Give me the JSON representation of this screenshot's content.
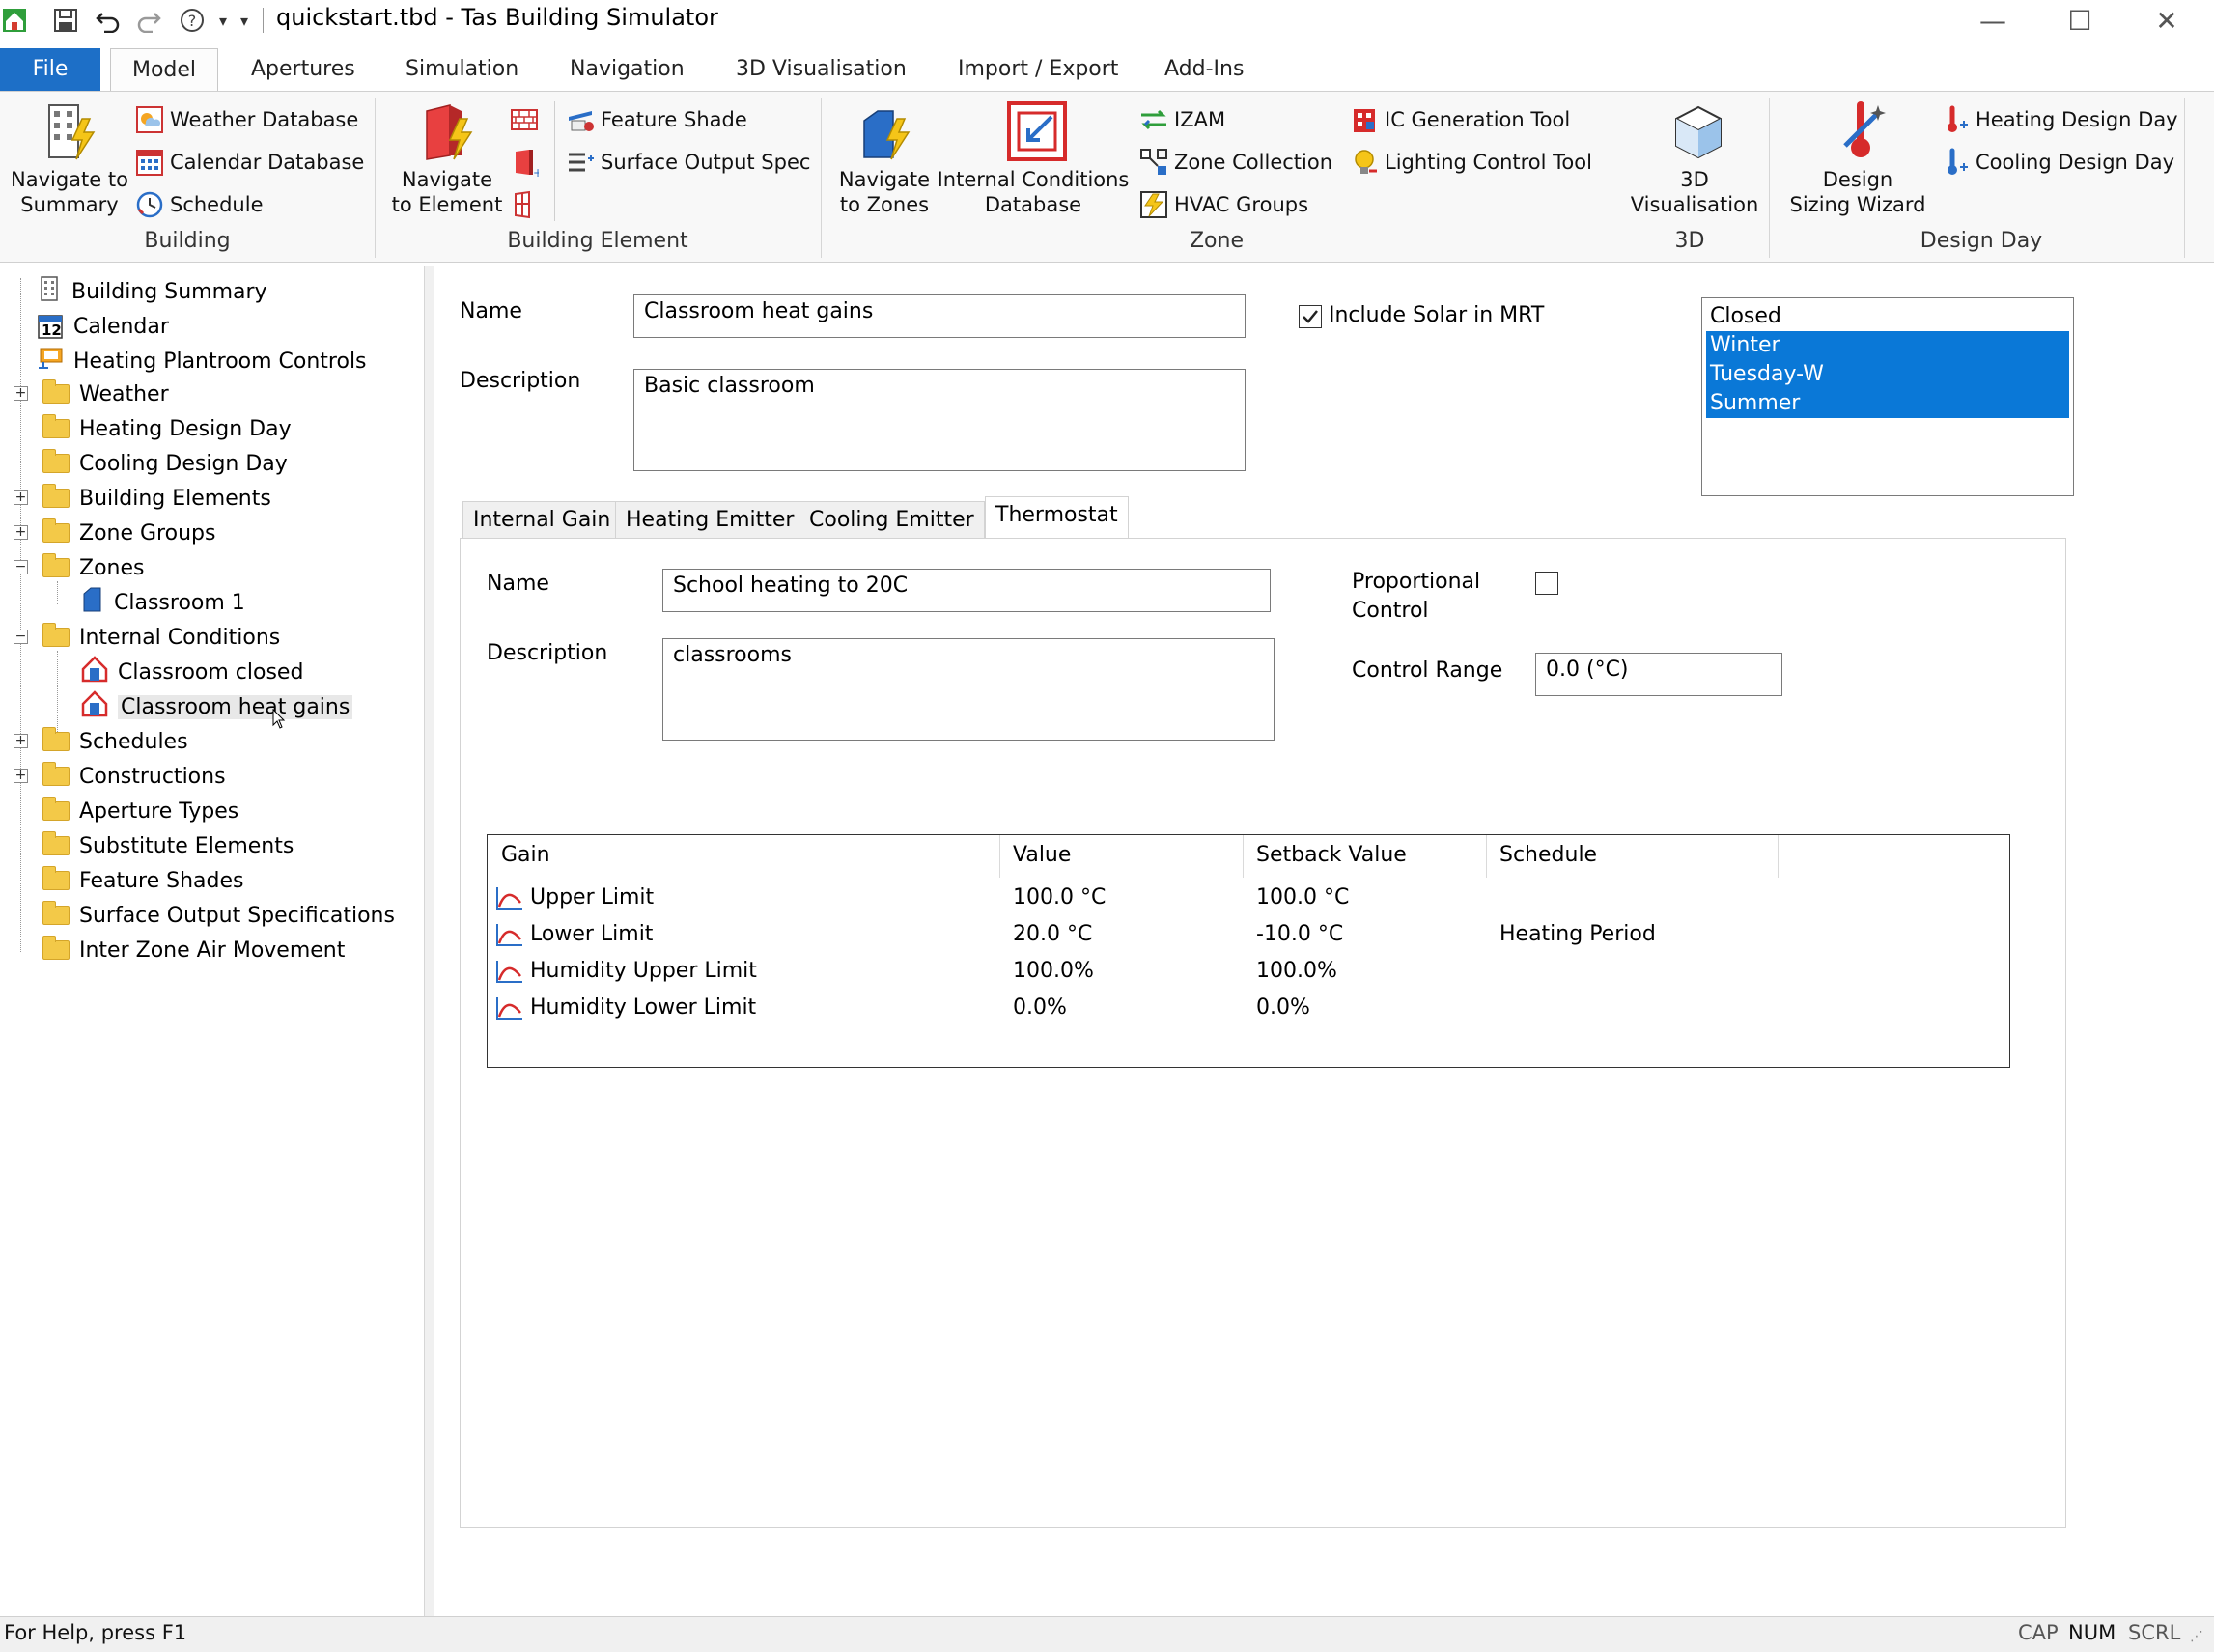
{
  "window": {
    "title": "quickstart.tbd - Tas Building Simulator",
    "minimize": "—",
    "maximize": "☐",
    "close": "✕"
  },
  "ribbon_tabs": [
    "File",
    "Model",
    "Apertures",
    "Simulation",
    "Navigation",
    "3D Visualisation",
    "Import / Export",
    "Add-Ins"
  ],
  "ribbon": {
    "building": {
      "label": "Building",
      "navigate_summary": [
        "Navigate to",
        "Summary"
      ],
      "weather_db": "Weather Database",
      "calendar_db": "Calendar Database",
      "schedule": "Schedule"
    },
    "building_element": {
      "label": "Building Element",
      "navigate_element": [
        "Navigate",
        "to Element"
      ],
      "feature_shade": "Feature Shade",
      "surface_output_spec": "Surface Output Spec"
    },
    "zone": {
      "label": "Zone",
      "navigate_zones": [
        "Navigate",
        "to Zones"
      ],
      "internal_conditions_db": [
        "Internal Conditions",
        "Database"
      ],
      "izam": "IZAM",
      "zone_collection": "Zone Collection",
      "hvac_groups": "HVAC Groups",
      "ic_generation_tool": "IC Generation Tool",
      "lighting_control_tool": "Lighting Control Tool"
    },
    "three_d": {
      "label": "3D",
      "visualisation": [
        "3D",
        "Visualisation"
      ]
    },
    "design_day": {
      "label": "Design Day",
      "sizing_wizard": [
        "Design",
        "Sizing Wizard"
      ],
      "heating_design_day": "Heating Design Day",
      "cooling_design_day": "Cooling Design Day"
    }
  },
  "tree": {
    "items": [
      "Building Summary",
      "Calendar",
      "Heating Plantroom Controls",
      "Weather",
      "Heating Design Day",
      "Cooling Design Day",
      "Building Elements",
      "Zone Groups",
      "Zones",
      "Classroom 1",
      "Internal Conditions",
      "Classroom closed",
      "Classroom heat gains",
      "Schedules",
      "Constructions",
      "Aperture Types",
      "Substitute Elements",
      "Feature Shades",
      "Surface Output Specifications",
      "Inter Zone Air Movement"
    ],
    "calendar_day": "12"
  },
  "form": {
    "name_label": "Name",
    "name_value": "Classroom heat gains",
    "description_label": "Description",
    "description_value": "Basic classroom",
    "include_solar_label": "Include Solar in MRT",
    "include_solar_checked": true,
    "day_types": [
      "Closed",
      "Winter",
      "Tuesday-W",
      "Summer"
    ],
    "day_types_selected": [
      "Winter",
      "Tuesday-W",
      "Summer"
    ]
  },
  "tabs": [
    "Internal Gain",
    "Heating Emitter",
    "Cooling Emitter",
    "Thermostat"
  ],
  "active_tab": "Thermostat",
  "thermostat": {
    "name_label": "Name",
    "name_value": "School heating to 20C",
    "description_label": "Description",
    "description_value": "classrooms",
    "proportional_label_1": "Proportional",
    "proportional_label_2": "Control",
    "proportional_checked": false,
    "control_range_label": "Control Range",
    "control_range_value": "0.0 (°C)"
  },
  "gain_table": {
    "headers": [
      "Gain",
      "Value",
      "Setback Value",
      "Schedule"
    ],
    "rows": [
      {
        "gain": "Upper Limit",
        "value": "100.0 °C",
        "setback": "100.0 °C",
        "schedule": ""
      },
      {
        "gain": "Lower Limit",
        "value": "20.0 °C",
        "setback": "-10.0 °C",
        "schedule": "Heating Period"
      },
      {
        "gain": "Humidity Upper Limit",
        "value": "100.0%",
        "setback": "100.0%",
        "schedule": ""
      },
      {
        "gain": "Humidity Lower Limit",
        "value": "0.0%",
        "setback": "0.0%",
        "schedule": ""
      }
    ]
  },
  "status": {
    "help": "For Help, press F1",
    "cap": "CAP",
    "num": "NUM",
    "scrl": "SCRL"
  },
  "colors": {
    "accent": "#1d6fc7",
    "selection": "#0a78d7",
    "folder": "#f3c948"
  }
}
